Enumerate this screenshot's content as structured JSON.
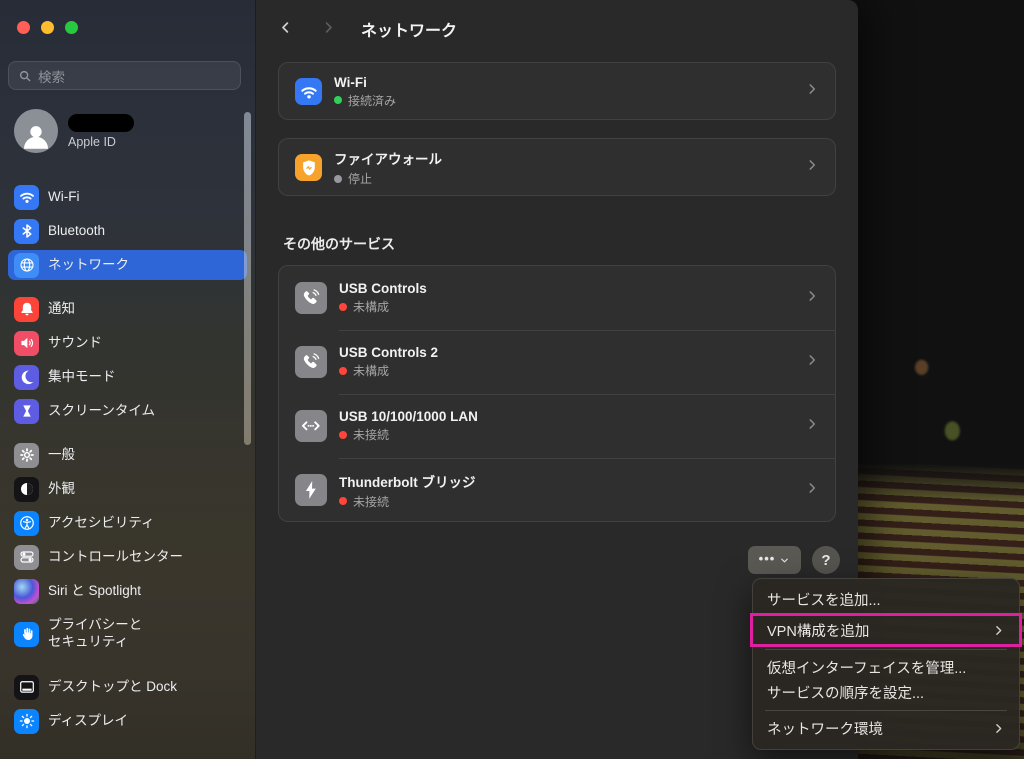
{
  "header": {
    "title": "ネットワーク"
  },
  "sidebar": {
    "search": {
      "placeholder": "検索"
    },
    "apple": {
      "label": "Apple ID"
    },
    "groups": [
      [
        {
          "id": "wifi",
          "label": "Wi-Fi",
          "icon": "wifi",
          "color": "#3478f6"
        },
        {
          "id": "bluetooth",
          "label": "Bluetooth",
          "icon": "bluetooth",
          "color": "#3478f6"
        },
        {
          "id": "network",
          "label": "ネットワーク",
          "icon": "globe",
          "color": "#3f8ef7",
          "selected": true
        }
      ],
      [
        {
          "id": "notifications",
          "label": "通知",
          "icon": "bell",
          "color": "#fc4439"
        },
        {
          "id": "sound",
          "label": "サウンド",
          "icon": "speaker",
          "color": "#ef4e66"
        },
        {
          "id": "focus",
          "label": "集中モード",
          "icon": "moon",
          "color": "#5d5ce2"
        },
        {
          "id": "screen-time",
          "label": "スクリーンタイム",
          "icon": "hourglass",
          "color": "#5d5ce2"
        }
      ],
      [
        {
          "id": "general",
          "label": "一般",
          "icon": "gear",
          "color": "#8e8e93"
        },
        {
          "id": "appearance",
          "label": "外観",
          "icon": "appearance",
          "color": "#141416"
        },
        {
          "id": "accessibility",
          "label": "アクセシビリティ",
          "icon": "accessibility",
          "color": "#0b84ff"
        },
        {
          "id": "control-center",
          "label": "コントロールセンター",
          "icon": "controlcenter",
          "color": "#8e8e93"
        },
        {
          "id": "siri-spotlight",
          "label": "Siri と Spotlight",
          "icon": "siri",
          "color": ""
        },
        {
          "id": "privacy-security",
          "label": "プライバシーと\nセキュリティ",
          "icon": "hand",
          "color": "#0b84ff",
          "twoLine": true
        }
      ],
      [
        {
          "id": "desktop-dock",
          "label": "デスクトップと Dock",
          "icon": "desktopdock",
          "color": "#141416"
        },
        {
          "id": "display",
          "label": "ディスプレイ",
          "icon": "display",
          "color": "#0b84ff"
        }
      ]
    ]
  },
  "main": {
    "top_cards": [
      {
        "id": "wifi",
        "title": "Wi-Fi",
        "status": "接続済み",
        "dot_color": "#30d158",
        "icon": "wifi",
        "icon_bg": "#3478f6"
      },
      {
        "id": "firewall",
        "title": "ファイアウォール",
        "status": "停止",
        "dot_color": "#98989d",
        "icon": "shield",
        "icon_bg": "#f7a32b"
      }
    ],
    "section_title": "その他のサービス",
    "services": [
      {
        "id": "usb-controls",
        "title": "USB Controls",
        "status": "未構成",
        "dot_color": "#ff453a",
        "icon": "phone"
      },
      {
        "id": "usb-controls-2",
        "title": "USB Controls 2",
        "status": "未構成",
        "dot_color": "#ff453a",
        "icon": "phone"
      },
      {
        "id": "usb-lan",
        "title": "USB 10/100/1000 LAN",
        "status": "未接続",
        "dot_color": "#ff453a",
        "icon": "lan"
      },
      {
        "id": "thunderbolt-bridge",
        "title": "Thunderbolt ブリッジ",
        "status": "未接続",
        "dot_color": "#ff453a",
        "icon": "bolt"
      }
    ],
    "more_button": {
      "dots": "•••"
    },
    "help_button": {
      "label": "?"
    }
  },
  "menu": {
    "highlight_color": "#de1fa0",
    "items": [
      {
        "id": "add-service",
        "label": "サービスを追加...",
        "type": "item"
      },
      {
        "id": "add-vpn-config",
        "label": "VPN構成を追加",
        "type": "item",
        "chevron": true,
        "highlighted": true
      },
      {
        "type": "separator"
      },
      {
        "id": "manage-virtual-interfaces",
        "label": "仮想インターフェイスを管理...",
        "type": "item"
      },
      {
        "id": "set-service-order",
        "label": "サービスの順序を設定...",
        "type": "item"
      },
      {
        "type": "separator"
      },
      {
        "id": "network-environment",
        "label": "ネットワーク環境",
        "type": "item",
        "chevron": true
      }
    ]
  }
}
